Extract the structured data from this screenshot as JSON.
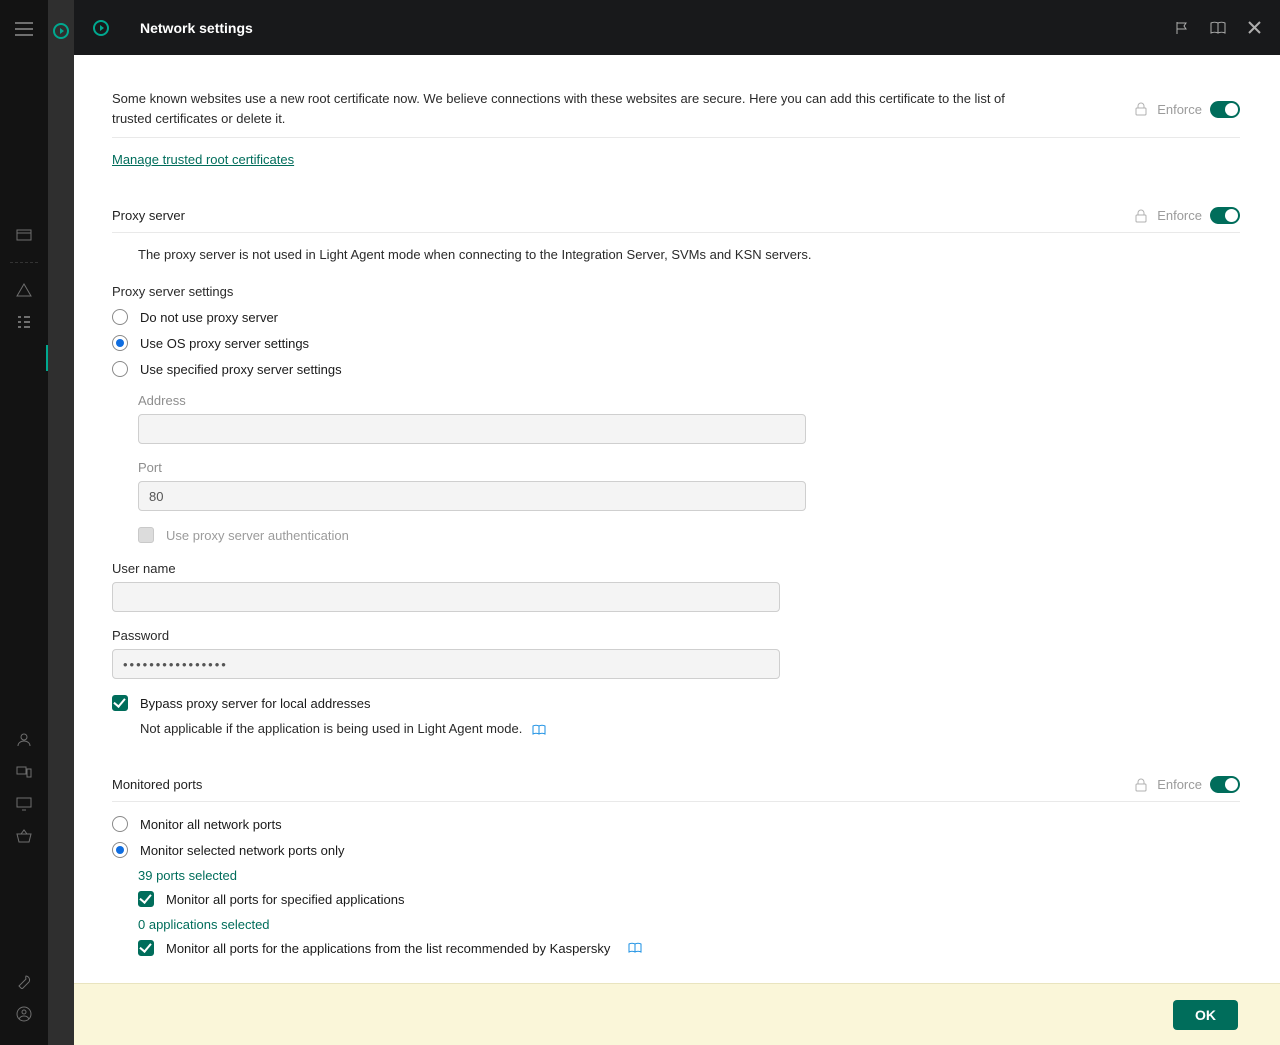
{
  "header": {
    "title": "Network settings"
  },
  "certificates": {
    "description": "Some known websites use a new root certificate now. We believe connections with these websites are secure. Here you can add this certificate to the list of trusted certificates or delete it.",
    "enforce_label": "Enforce",
    "manage_link": "Manage trusted root certificates"
  },
  "proxy": {
    "title": "Proxy server",
    "enforce_label": "Enforce",
    "note": "The proxy server is not used in Light Agent mode when connecting to the Integration Server, SVMs and KSN servers.",
    "settings_label": "Proxy server settings",
    "radios": {
      "do_not_use": "Do not use proxy server",
      "use_os": "Use OS proxy server settings",
      "use_specified": "Use specified proxy server settings"
    },
    "address_label": "Address",
    "address_value": "",
    "port_label": "Port",
    "port_value": "80",
    "auth_label": "Use proxy server authentication",
    "username_label": "User name",
    "username_value": "",
    "password_label": "Password",
    "password_value": "••••••••••••••••",
    "bypass_label": "Bypass proxy server for local addresses",
    "bypass_note": "Not applicable if the application is being used in Light Agent mode."
  },
  "ports": {
    "title": "Monitored ports",
    "enforce_label": "Enforce",
    "radios": {
      "all": "Monitor all network ports",
      "selected": "Monitor selected network ports only"
    },
    "ports_link": "39 ports selected",
    "chk_apps": "Monitor all ports for specified applications",
    "apps_link": "0 applications selected",
    "chk_recommended": "Monitor all ports for the applications from the list recommended by Kaspersky"
  },
  "footer": {
    "ok": "OK"
  }
}
